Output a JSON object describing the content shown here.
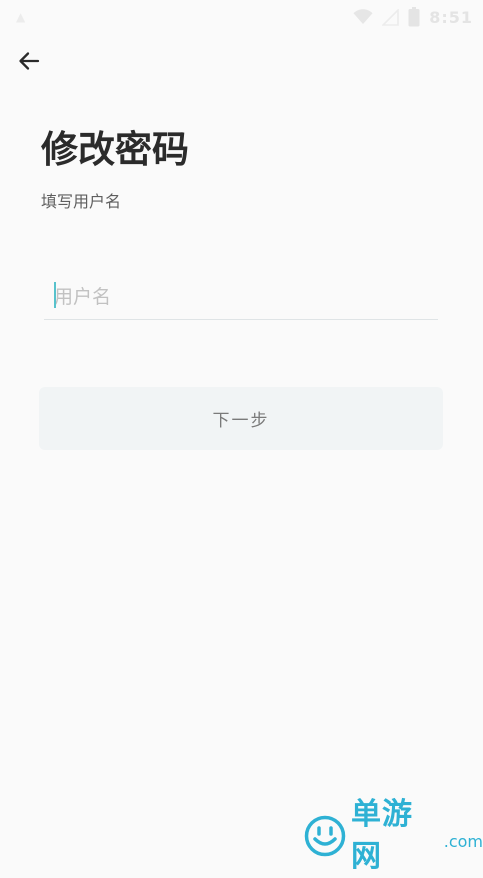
{
  "status_bar": {
    "time": "8:51",
    "icons": [
      "wifi-icon",
      "signal-icon",
      "battery-icon"
    ]
  },
  "nav": {
    "back_icon": "arrow-left-icon"
  },
  "page": {
    "title": "修改密码",
    "subtitle": "填写用户名"
  },
  "form": {
    "username": {
      "placeholder": "用户名",
      "value": ""
    },
    "next_button_label": "下一步"
  },
  "watermark": {
    "name": "单游网",
    "domain": ".com"
  },
  "colors": {
    "background": "#fafafa",
    "title": "#2b2b2b",
    "cursor_accent": "#57c2cc",
    "button_background": "#f1f4f5",
    "watermark": "#2eb1d4"
  }
}
